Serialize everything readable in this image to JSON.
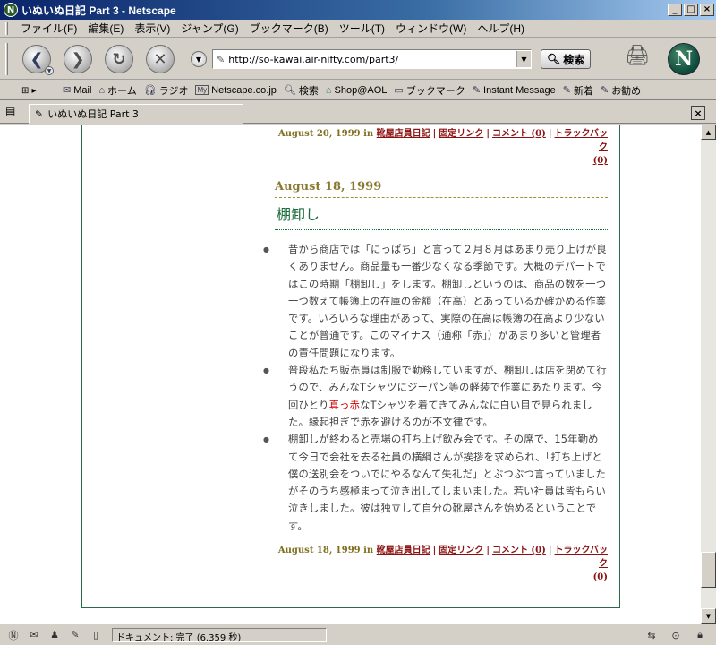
{
  "window": {
    "title": "いぬいぬ日記 Part 3 - Netscape",
    "buttons": [
      "_",
      "□",
      "×"
    ]
  },
  "menubar": [
    "ファイル(F)",
    "編集(E)",
    "表示(V)",
    "ジャンプ(G)",
    "ブックマーク(B)",
    "ツール(T)",
    "ウィンドウ(W)",
    "ヘルプ(H)"
  ],
  "navigation": {
    "url": "http://so-kawai.air-nifty.com/part3/",
    "search_label": "検索"
  },
  "personal_toolbar": [
    {
      "icon": "mail-icon",
      "label": "Mail"
    },
    {
      "icon": "home-icon",
      "label": "ホーム"
    },
    {
      "icon": "headphones-icon",
      "label": "ラジオ"
    },
    {
      "icon": "my-icon",
      "label": "Netscape.co.jp"
    },
    {
      "icon": "search-icon",
      "label": "検索"
    },
    {
      "icon": "shop-icon",
      "label": "Shop@AOL"
    },
    {
      "icon": "folder-icon",
      "label": "ブックマーク"
    },
    {
      "icon": "bookmark-icon",
      "label": "Instant Message"
    },
    {
      "icon": "bookmark-icon",
      "label": "新着"
    },
    {
      "icon": "bookmark-icon",
      "label": "お勧め"
    }
  ],
  "tab": {
    "title": "いぬいぬ日記 Part 3"
  },
  "posts": {
    "prev_footer": {
      "date": "August 20, 1999 in",
      "category": "靴屋店員日記",
      "permalink": "固定リンク",
      "comments": "コメント (0)",
      "trackback": "トラックバック",
      "trackback_count": "(0)"
    },
    "current": {
      "date": "August 18, 1999",
      "title": "棚卸し",
      "paragraphs": [
        [
          "昔から商店では「にっぱち」と言って２月８月はあまり売り上げが良くありません。商品量も一番少なくなる季節です。大概のデパートではこの時期「棚卸し」をします。棚卸しというのは、商品の数を一つ一つ数えて帳簿上の在庫の金額（在高）とあっているか確かめる作業です。いろいろな理由があって、実際の在高は帳簿の在高より少ないことが普通です。このマイナス（通称「赤」）があまり多いと管理者の責任問題になります。"
        ],
        [
          "普段私たち販売員は制服で勤務していますが、棚卸しは店を閉めて行うので、みんなTシャツにジーパン等の軽装で作業にあたります。今回ひとり",
          "真っ赤",
          "なTシャツを着てきてみんなに白い目で見られました。縁起担ぎで赤を避けるのが不文律です。"
        ],
        [
          "棚卸しが終わると売場の打ち上げ飲み会です。その席で、15年勤めて今日で会社を去る社員の横綱さんが挨拶を求められ、「打ち上げと僕の送別会をついでにやるなんて失礼だ」とぶつぶつ言っていましたがそのうち感極まって泣き出してしまいました。若い社員は皆もらい泣きしました。彼は独立して自分の靴屋さんを始めるということです。"
        ]
      ],
      "footer": {
        "date": "August 18, 1999 in",
        "category": "靴屋店員日記",
        "permalink": "固定リンク",
        "comments": "コメント (0)",
        "trackback": "トラックバック",
        "trackback_count": "(0)"
      }
    }
  },
  "status": {
    "text": "ドキュメント: 完了 (6.359 秒)"
  }
}
